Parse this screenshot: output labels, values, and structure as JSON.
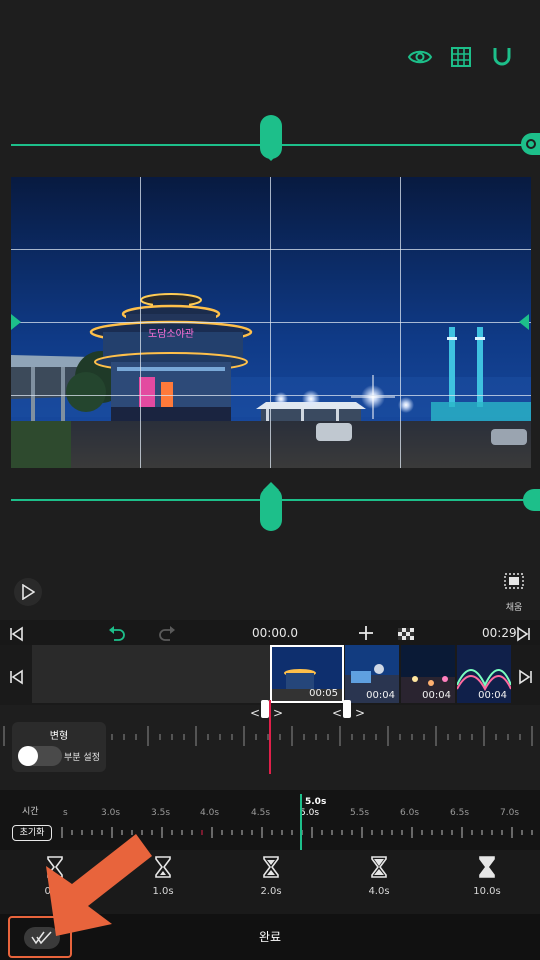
{
  "toolbar": {
    "icons": [
      "eye-icon",
      "grid-icon",
      "magnet-icon"
    ],
    "accent": "#1dbf8a"
  },
  "preview": {
    "sign_text": "도담소야관"
  },
  "player": {
    "fill_label": "채움"
  },
  "timeline": {
    "current_time": "00:00.0",
    "end_time": "00:29",
    "clips": [
      {
        "duration": "00:05"
      },
      {
        "duration": "00:04"
      },
      {
        "duration": "00:04"
      },
      {
        "duration": "00:04"
      }
    ]
  },
  "transform": {
    "title": "변형",
    "partial_label": "부분 설정",
    "partial_enabled": false
  },
  "speed": {
    "label": "시간",
    "reset_label": "초기화",
    "current": "5.0s",
    "ticks": [
      "s",
      "3.0s",
      "3.5s",
      "4.0s",
      "4.5s",
      "5.0s",
      "5.5s",
      "6.0s",
      "6.5s",
      "7.0s"
    ]
  },
  "presets": [
    {
      "label": "0.5s"
    },
    {
      "label": "1.0s"
    },
    {
      "label": "2.0s"
    },
    {
      "label": "4.0s"
    },
    {
      "label": "10.0s"
    }
  ],
  "bottom": {
    "done_label": "완료",
    "highlight_color": "#e8643c"
  }
}
